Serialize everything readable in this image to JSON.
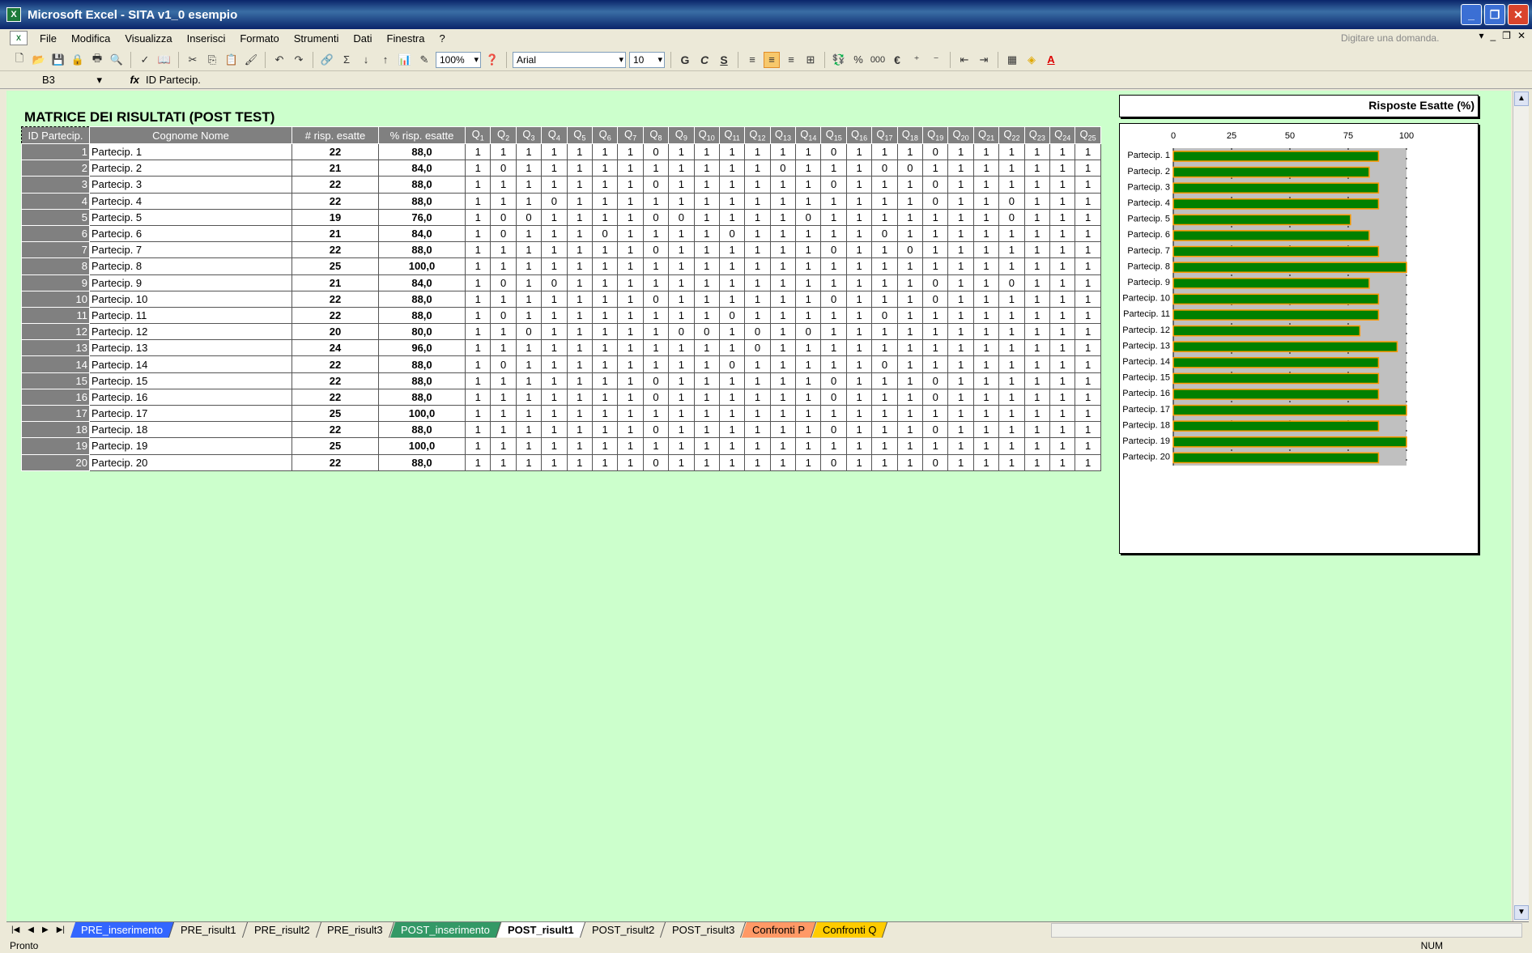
{
  "window": {
    "title": "Microsoft Excel - SITA v1_0 esempio",
    "btn_min": "_",
    "btn_max": "❐",
    "btn_close": "✕"
  },
  "menu": {
    "items": [
      "File",
      "Modifica",
      "Visualizza",
      "Inserisci",
      "Formato",
      "Strumenti",
      "Dati",
      "Finestra",
      "?"
    ],
    "ask_placeholder": "Digitare una domanda.",
    "ask_arrow": "▾",
    "doc_min": "_",
    "doc_restore": "❐",
    "doc_close": "✕"
  },
  "toolbar": {
    "zoom": "100%",
    "font": "Arial",
    "font_size": "10",
    "bold": "G",
    "italic": "C",
    "underline": "S",
    "percent": "%",
    "thousands": "000",
    "euro": "€",
    "sigma": "Σ"
  },
  "formula_bar": {
    "cell_ref": "B3",
    "fx": "fx",
    "content": "ID Partecip."
  },
  "sheet": {
    "title": "MATRICE DEI RISULTATI (POST TEST)",
    "headers": {
      "id": "ID Partecip.",
      "name": "Cognome Nome",
      "correct": "# risp. esatte",
      "percent": "% risp. esatte"
    },
    "q_prefix": "Q",
    "questions": [
      "1",
      "2",
      "3",
      "4",
      "5",
      "6",
      "7",
      "8",
      "9",
      "10",
      "11",
      "12",
      "13",
      "14",
      "15",
      "16",
      "17",
      "18",
      "19",
      "20",
      "21",
      "22",
      "23",
      "24",
      "25"
    ],
    "rows": [
      {
        "id": "1",
        "name": "Partecip. 1",
        "correct": "22",
        "pct": "88,0",
        "answers": [
          1,
          1,
          1,
          1,
          1,
          1,
          1,
          0,
          1,
          1,
          1,
          1,
          1,
          1,
          0,
          1,
          1,
          1,
          0,
          1,
          1,
          1,
          1,
          1,
          1
        ]
      },
      {
        "id": "2",
        "name": "Partecip. 2",
        "correct": "21",
        "pct": "84,0",
        "answers": [
          1,
          0,
          1,
          1,
          1,
          1,
          1,
          1,
          1,
          1,
          1,
          1,
          0,
          1,
          1,
          1,
          0,
          0,
          1,
          1,
          1,
          1,
          1,
          1,
          1
        ]
      },
      {
        "id": "3",
        "name": "Partecip. 3",
        "correct": "22",
        "pct": "88,0",
        "answers": [
          1,
          1,
          1,
          1,
          1,
          1,
          1,
          0,
          1,
          1,
          1,
          1,
          1,
          1,
          0,
          1,
          1,
          1,
          0,
          1,
          1,
          1,
          1,
          1,
          1
        ]
      },
      {
        "id": "4",
        "name": "Partecip. 4",
        "correct": "22",
        "pct": "88,0",
        "answers": [
          1,
          1,
          1,
          0,
          1,
          1,
          1,
          1,
          1,
          1,
          1,
          1,
          1,
          1,
          1,
          1,
          1,
          1,
          0,
          1,
          1,
          0,
          1,
          1,
          1
        ]
      },
      {
        "id": "5",
        "name": "Partecip. 5",
        "correct": "19",
        "pct": "76,0",
        "answers": [
          1,
          0,
          0,
          1,
          1,
          1,
          1,
          0,
          0,
          1,
          1,
          1,
          1,
          0,
          1,
          1,
          1,
          1,
          1,
          1,
          1,
          0,
          1,
          1,
          1
        ]
      },
      {
        "id": "6",
        "name": "Partecip. 6",
        "correct": "21",
        "pct": "84,0",
        "answers": [
          1,
          0,
          1,
          1,
          1,
          0,
          1,
          1,
          1,
          1,
          0,
          1,
          1,
          1,
          1,
          1,
          0,
          1,
          1,
          1,
          1,
          1,
          1,
          1,
          1
        ]
      },
      {
        "id": "7",
        "name": "Partecip. 7",
        "correct": "22",
        "pct": "88,0",
        "answers": [
          1,
          1,
          1,
          1,
          1,
          1,
          1,
          0,
          1,
          1,
          1,
          1,
          1,
          1,
          0,
          1,
          1,
          0,
          1,
          1,
          1,
          1,
          1,
          1,
          1
        ]
      },
      {
        "id": "8",
        "name": "Partecip. 8",
        "correct": "25",
        "pct": "100,0",
        "answers": [
          1,
          1,
          1,
          1,
          1,
          1,
          1,
          1,
          1,
          1,
          1,
          1,
          1,
          1,
          1,
          1,
          1,
          1,
          1,
          1,
          1,
          1,
          1,
          1,
          1
        ]
      },
      {
        "id": "9",
        "name": "Partecip. 9",
        "correct": "21",
        "pct": "84,0",
        "answers": [
          1,
          0,
          1,
          0,
          1,
          1,
          1,
          1,
          1,
          1,
          1,
          1,
          1,
          1,
          1,
          1,
          1,
          1,
          0,
          1,
          1,
          0,
          1,
          1,
          1
        ]
      },
      {
        "id": "10",
        "name": "Partecip. 10",
        "correct": "22",
        "pct": "88,0",
        "answers": [
          1,
          1,
          1,
          1,
          1,
          1,
          1,
          0,
          1,
          1,
          1,
          1,
          1,
          1,
          0,
          1,
          1,
          1,
          0,
          1,
          1,
          1,
          1,
          1,
          1
        ]
      },
      {
        "id": "11",
        "name": "Partecip. 11",
        "correct": "22",
        "pct": "88,0",
        "answers": [
          1,
          0,
          1,
          1,
          1,
          1,
          1,
          1,
          1,
          1,
          0,
          1,
          1,
          1,
          1,
          1,
          0,
          1,
          1,
          1,
          1,
          1,
          1,
          1,
          1
        ]
      },
      {
        "id": "12",
        "name": "Partecip. 12",
        "correct": "20",
        "pct": "80,0",
        "answers": [
          1,
          1,
          0,
          1,
          1,
          1,
          1,
          1,
          0,
          0,
          1,
          0,
          1,
          0,
          1,
          1,
          1,
          1,
          1,
          1,
          1,
          1,
          1,
          1,
          1
        ]
      },
      {
        "id": "13",
        "name": "Partecip. 13",
        "correct": "24",
        "pct": "96,0",
        "answers": [
          1,
          1,
          1,
          1,
          1,
          1,
          1,
          1,
          1,
          1,
          1,
          0,
          1,
          1,
          1,
          1,
          1,
          1,
          1,
          1,
          1,
          1,
          1,
          1,
          1
        ]
      },
      {
        "id": "14",
        "name": "Partecip. 14",
        "correct": "22",
        "pct": "88,0",
        "answers": [
          1,
          0,
          1,
          1,
          1,
          1,
          1,
          1,
          1,
          1,
          0,
          1,
          1,
          1,
          1,
          1,
          0,
          1,
          1,
          1,
          1,
          1,
          1,
          1,
          1
        ]
      },
      {
        "id": "15",
        "name": "Partecip. 15",
        "correct": "22",
        "pct": "88,0",
        "answers": [
          1,
          1,
          1,
          1,
          1,
          1,
          1,
          0,
          1,
          1,
          1,
          1,
          1,
          1,
          0,
          1,
          1,
          1,
          0,
          1,
          1,
          1,
          1,
          1,
          1
        ]
      },
      {
        "id": "16",
        "name": "Partecip. 16",
        "correct": "22",
        "pct": "88,0",
        "answers": [
          1,
          1,
          1,
          1,
          1,
          1,
          1,
          0,
          1,
          1,
          1,
          1,
          1,
          1,
          0,
          1,
          1,
          1,
          0,
          1,
          1,
          1,
          1,
          1,
          1
        ]
      },
      {
        "id": "17",
        "name": "Partecip. 17",
        "correct": "25",
        "pct": "100,0",
        "answers": [
          1,
          1,
          1,
          1,
          1,
          1,
          1,
          1,
          1,
          1,
          1,
          1,
          1,
          1,
          1,
          1,
          1,
          1,
          1,
          1,
          1,
          1,
          1,
          1,
          1
        ]
      },
      {
        "id": "18",
        "name": "Partecip. 18",
        "correct": "22",
        "pct": "88,0",
        "answers": [
          1,
          1,
          1,
          1,
          1,
          1,
          1,
          0,
          1,
          1,
          1,
          1,
          1,
          1,
          0,
          1,
          1,
          1,
          0,
          1,
          1,
          1,
          1,
          1,
          1
        ]
      },
      {
        "id": "19",
        "name": "Partecip. 19",
        "correct": "25",
        "pct": "100,0",
        "answers": [
          1,
          1,
          1,
          1,
          1,
          1,
          1,
          1,
          1,
          1,
          1,
          1,
          1,
          1,
          1,
          1,
          1,
          1,
          1,
          1,
          1,
          1,
          1,
          1,
          1
        ]
      },
      {
        "id": "20",
        "name": "Partecip. 20",
        "correct": "22",
        "pct": "88,0",
        "answers": [
          1,
          1,
          1,
          1,
          1,
          1,
          1,
          0,
          1,
          1,
          1,
          1,
          1,
          1,
          0,
          1,
          1,
          1,
          0,
          1,
          1,
          1,
          1,
          1,
          1
        ]
      }
    ]
  },
  "chart_data": {
    "type": "bar",
    "orientation": "horizontal",
    "title": "Risposte Esatte (%)",
    "categories": [
      "Partecip. 1",
      "Partecip. 2",
      "Partecip. 3",
      "Partecip. 4",
      "Partecip. 5",
      "Partecip. 6",
      "Partecip. 7",
      "Partecip. 8",
      "Partecip. 9",
      "Partecip. 10",
      "Partecip. 11",
      "Partecip. 12",
      "Partecip. 13",
      "Partecip. 14",
      "Partecip. 15",
      "Partecip. 16",
      "Partecip. 17",
      "Partecip. 18",
      "Partecip. 19",
      "Partecip. 20"
    ],
    "values": [
      88,
      84,
      88,
      88,
      76,
      84,
      88,
      100,
      84,
      88,
      88,
      80,
      96,
      88,
      88,
      88,
      100,
      88,
      100,
      88
    ],
    "xlim": [
      0,
      100
    ],
    "xticks": [
      "0",
      "25",
      "50",
      "75",
      "100"
    ],
    "grid": true,
    "bar_color": "#008000",
    "bar_border": "#ff9900",
    "plot_bg": "#c0c0c0"
  },
  "tabs": {
    "items": [
      {
        "label": "PRE_inserimento",
        "bg": "#3366ff",
        "fg": "#ffffff"
      },
      {
        "label": "PRE_risult1",
        "bg": "",
        "fg": "#000000"
      },
      {
        "label": "PRE_risult2",
        "bg": "",
        "fg": "#000000"
      },
      {
        "label": "PRE_risult3",
        "bg": "",
        "fg": "#000000"
      },
      {
        "label": "POST_inserimento",
        "bg": "#339966",
        "fg": "#ffffff"
      },
      {
        "label": "POST_risult1",
        "bg": "#ffffff",
        "fg": "#000000",
        "active": true
      },
      {
        "label": "POST_risult2",
        "bg": "",
        "fg": "#000000"
      },
      {
        "label": "POST_risult3",
        "bg": "",
        "fg": "#000000"
      },
      {
        "label": "Confronti P",
        "bg": "#ff9966",
        "fg": "#000000"
      },
      {
        "label": "Confronti Q",
        "bg": "#ffcc00",
        "fg": "#000000"
      }
    ]
  },
  "status": {
    "left": "Pronto",
    "right": "NUM"
  }
}
